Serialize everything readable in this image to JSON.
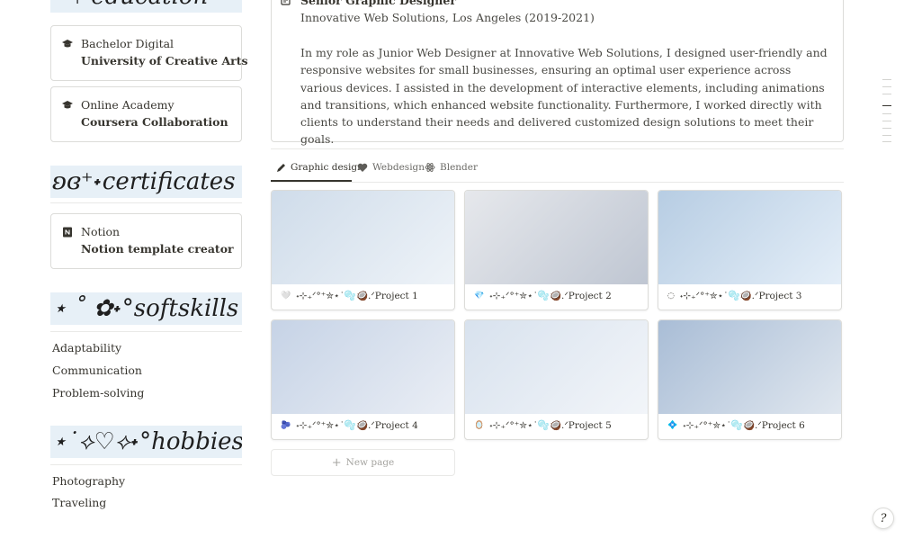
{
  "sections": {
    "education_heading": "·˚₊‧education",
    "certificates_heading": "ʚɞ⁺˖certificates",
    "softskills_heading": "⋆ ˚ ✿˖°softskills",
    "hobbies_heading": "⋆˙⟡♡⟡˖°hobbies"
  },
  "education": [
    {
      "line1": "Bachelor Digital",
      "line2": "University of Creative Arts"
    },
    {
      "line1": "Online Academy",
      "line2": "Coursera Collaboration"
    }
  ],
  "certificates": [
    {
      "line1": "Notion",
      "line2": "Notion template creator"
    }
  ],
  "softskills": [
    "Adaptability",
    "Communication",
    "Problem-solving"
  ],
  "hobbies": [
    "Photography",
    "Traveling"
  ],
  "experience": {
    "title": "Senior Graphic Designer",
    "subtitle": "Innovative Web Solutions, Los Angeles (2019-2021)",
    "body": "In my role as Junior Web Designer at Innovative Web Solutions, I designed user-friendly and responsive websites for small businesses, ensuring an optimal user experience across various devices. I assisted in the development of interactive elements, including animations and transitions, which enhanced website functionality. Furthermore, I worked directly with clients to understand their needs and delivered customized design solutions to meet their goals."
  },
  "tabs": [
    {
      "label": "Graphic design",
      "icon": "pencil-icon",
      "active": true
    },
    {
      "label": "Webdesign",
      "icon": "heart-icon",
      "active": false
    },
    {
      "label": "Blender",
      "icon": "atom-icon",
      "active": false
    }
  ],
  "gallery": [
    {
      "icon": "🤍",
      "title": "˖⊹₊ᐟ°⁺✮⋆˙🫧🥥.ᐟProject 1",
      "colors": [
        "#cfdcea",
        "#eef3f8"
      ]
    },
    {
      "icon": "💎",
      "title": "˖⊹₊ᐟ°⁺✮⋆˙🫧🥥.ᐟProject 2",
      "colors": [
        "#e6e8ec",
        "#bfc6d2"
      ]
    },
    {
      "icon": "◌",
      "title": "˖⊹₊ᐟ°⁺✮⋆˙🫧🥥.ᐟProject 3",
      "colors": [
        "#b7cde3",
        "#e4eef8"
      ]
    },
    {
      "icon": "🫐",
      "title": "˖⊹₊ᐟ°⁺✮⋆˙🫧🥥.ᐟProject 4",
      "colors": [
        "#c6d3e6",
        "#eaeef5"
      ]
    },
    {
      "icon": "🪞",
      "title": "˖⊹₊ᐟ°⁺✮⋆˙🫧🥥.ᐟProject 5",
      "colors": [
        "#d8e2ee",
        "#f2f5f9"
      ]
    },
    {
      "icon": "💠",
      "title": "˖⊹₊ᐟ°⁺✮⋆˙🫧🥥.ᐟProject 6",
      "colors": [
        "#a9bdd6",
        "#e0e7ef"
      ]
    }
  ],
  "new_page_label": "New page",
  "help_label": "?"
}
